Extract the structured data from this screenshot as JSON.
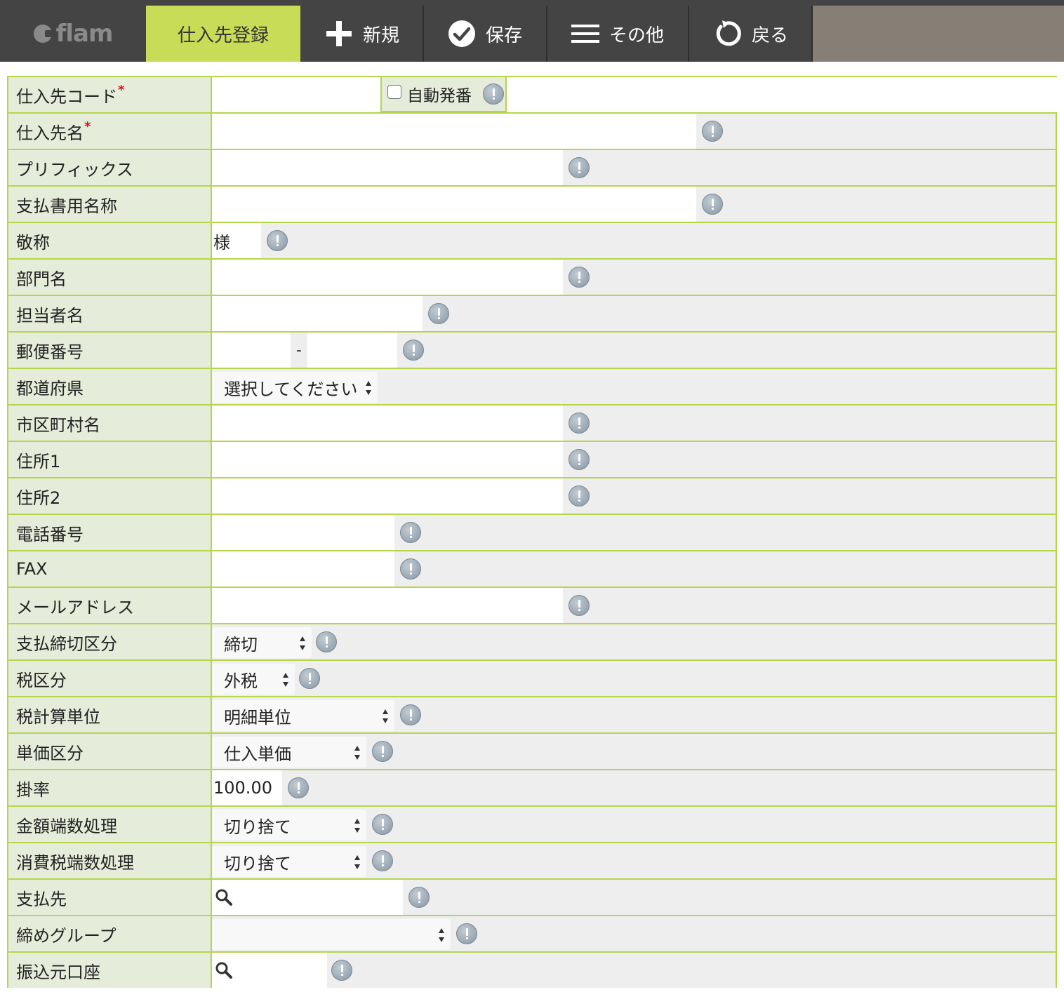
{
  "app": {
    "logo_text": "flam"
  },
  "toolbar": {
    "active_tab": "仕入先登録",
    "new_label": "新規",
    "save_label": "保存",
    "other_label": "その他",
    "back_label": "戻る"
  },
  "form": {
    "code_label": "仕入先コード",
    "required_mark": "*",
    "auto_number_label": "自動発番",
    "auto_number_checked": false,
    "name_label": "仕入先名",
    "prefix_label": "プリフィックス",
    "payment_doc_name_label": "支払書用名称",
    "honorific_label": "敬称",
    "honorific_value": "様",
    "department_label": "部門名",
    "contact_label": "担当者名",
    "postal_label": "郵便番号",
    "postal_separator": "-",
    "prefecture_label": "都道府県",
    "prefecture_value": "選択してください",
    "city_label": "市区町村名",
    "address1_label": "住所1",
    "address2_label": "住所2",
    "phone_label": "電話番号",
    "fax_label": "FAX",
    "email_label": "メールアドレス",
    "closing_type_label": "支払締切区分",
    "closing_type_value": "締切",
    "tax_type_label": "税区分",
    "tax_type_value": "外税",
    "tax_calc_unit_label": "税計算単位",
    "tax_calc_unit_value": "明細単位",
    "unit_price_type_label": "単価区分",
    "unit_price_type_value": "仕入単価",
    "rate_label": "掛率",
    "rate_value": "100.00",
    "amount_rounding_label": "金額端数処理",
    "amount_rounding_value": "切り捨て",
    "tax_rounding_label": "消費税端数処理",
    "tax_rounding_value": "切り捨て",
    "payee_label": "支払先",
    "closing_group_label": "締めグループ",
    "closing_group_value": "",
    "source_account_label": "振込元口座"
  },
  "colors": {
    "toolbar_bg": "#444444",
    "active_tab": "#c8dc58",
    "label_bg": "#e6ecda",
    "border": "#b6d54c",
    "required": "#d8121a"
  }
}
